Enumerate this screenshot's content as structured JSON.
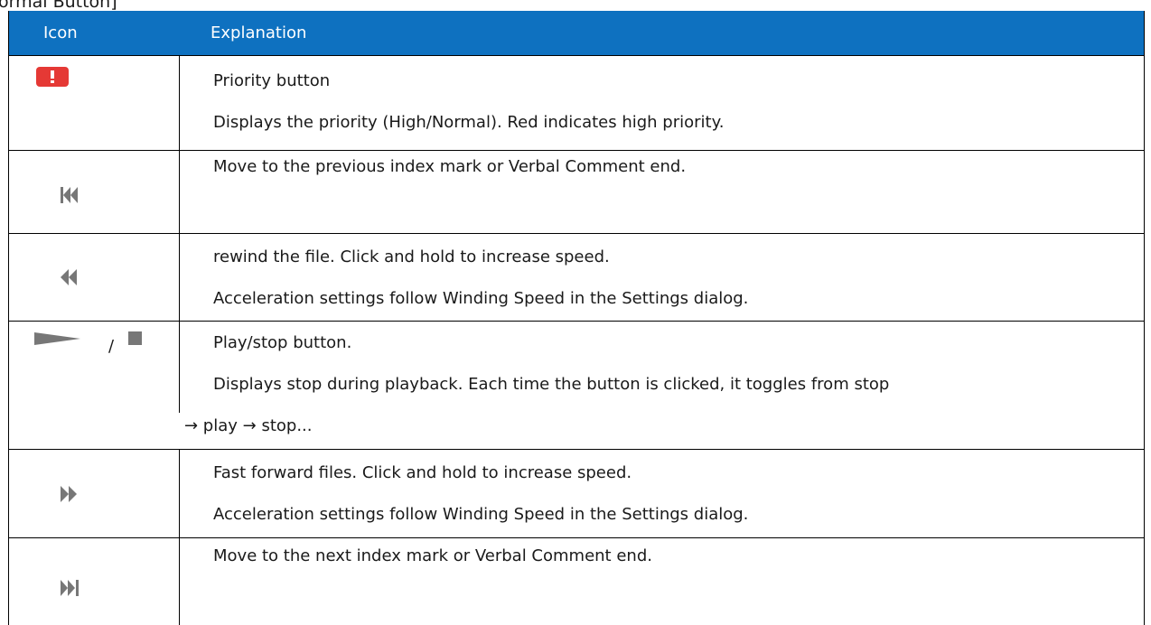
{
  "caption": "ormal Button]",
  "header": {
    "icon": "Icon",
    "explanation": "Explanation"
  },
  "colors": {
    "header_bg": "#0e71c0",
    "priority_red": "#e53935",
    "icon_gray": "#777777"
  },
  "rows": [
    {
      "icon": "priority-icon",
      "lines": [
        "Priority button",
        "Displays the priority (High/Normal). Red indicates high priority."
      ]
    },
    {
      "icon": "skip-previous-icon",
      "lines": [
        "Move to the previous index mark or Verbal Comment end."
      ]
    },
    {
      "icon": "rewind-icon",
      "lines": [
        "rewind the file. Click and hold to increase speed.",
        "Acceleration settings follow Winding Speed in the Settings dialog."
      ]
    },
    {
      "icon": "play-stop-icon",
      "icon_separator": "/",
      "lines": [
        "Play/stop button.",
        "Displays stop during playback. Each time the button is clicked, it toggles from stop",
        "→ play → stop..."
      ]
    },
    {
      "icon": "fast-forward-icon",
      "lines": [
        "Fast forward files. Click and hold to increase speed.",
        "Acceleration settings follow Winding Speed in the Settings dialog."
      ]
    },
    {
      "icon": "skip-next-icon",
      "lines": [
        "Move to the next index mark or Verbal Comment end."
      ]
    }
  ]
}
